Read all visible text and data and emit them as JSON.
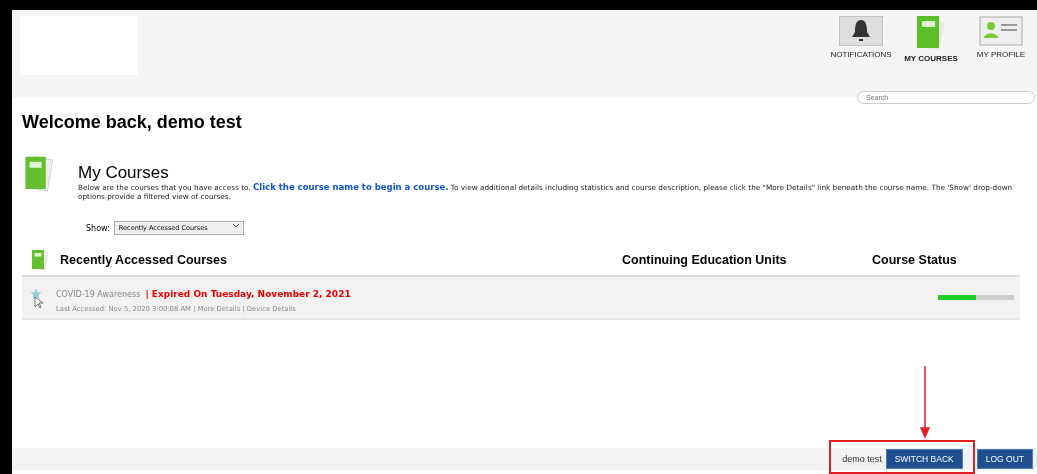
{
  "nav": [
    {
      "label": "NOTIFICATIONS",
      "kind": "bell",
      "selected": false
    },
    {
      "label": "MY COURSES",
      "kind": "book",
      "selected": true
    },
    {
      "label": "MY PROFILE",
      "kind": "profile",
      "selected": false
    }
  ],
  "search": {
    "placeholder": "Search"
  },
  "welcome": "Welcome back, demo test",
  "section": {
    "title": "My Courses",
    "intro": "Below are the courses that you have access to.",
    "link": "Click the course name to begin a course.",
    "rest": "To view additional details including statistics and course description, please click the \"More Details\" link beneath the course name. The 'Show' drop-down options provide a filtered view of courses."
  },
  "filter": {
    "label": "Show:",
    "value": "Recently Accessed Courses"
  },
  "table": {
    "columns": [
      "Recently Accessed Courses",
      "Continuing Education Units",
      "Course Status"
    ],
    "rows": [
      {
        "name": "COVID-19 Awareness",
        "separator": "|",
        "status": "Expired On Tuesday, November 2, 2021",
        "accessed": "Last Accessed: Nov 5, 2020 3:00:08 AM",
        "links": [
          "More Details",
          "Device Details"
        ],
        "level": 0.5
      }
    ]
  },
  "footer": {
    "user": "demo test",
    "buttons": [
      {
        "label": "SWITCH BACK"
      },
      {
        "label": "LOG OUT"
      }
    ]
  }
}
